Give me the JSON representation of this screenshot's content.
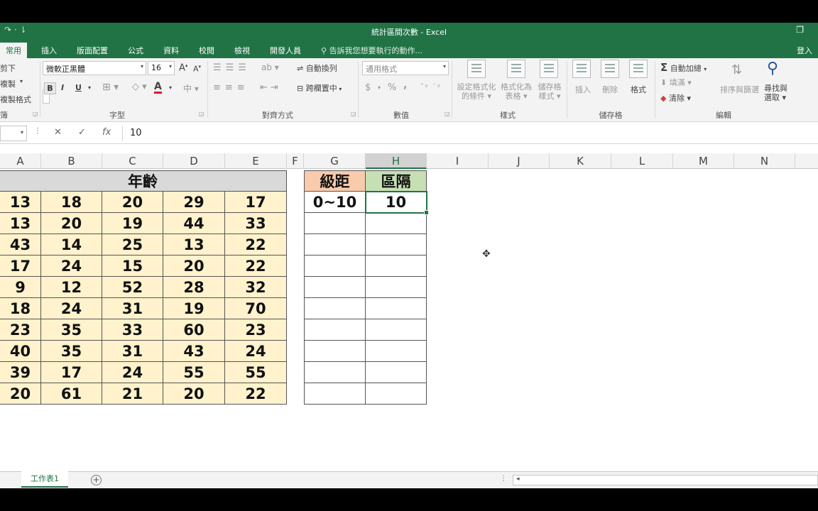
{
  "window": {
    "title": "統計區間次數 - Excel",
    "restore_icon": "restore-window-icon"
  },
  "tabs": {
    "items": [
      "常用",
      "插入",
      "版面配置",
      "公式",
      "資料",
      "校閱",
      "檢視",
      "開發人員"
    ],
    "active": "常用",
    "tell_me": "告訴我您想要執行的動作...",
    "signin": "登入"
  },
  "ribbon": {
    "clipboard": {
      "cut": "剪下",
      "copy": "複製",
      "format_painter": "複製格式",
      "group_label": "簿"
    },
    "font": {
      "name": "微軟正黑體",
      "size": "16",
      "bold": "B",
      "italic": "I",
      "underline": "U",
      "grow": "A",
      "shrink": "A",
      "font_color": "A",
      "font_color_hex": "#e81123",
      "group_label": "字型"
    },
    "alignment": {
      "wrap": "自動換列",
      "merge": "跨欄置中",
      "group_label": "對齊方式"
    },
    "number": {
      "format": "通用格式",
      "currency": "$",
      "percent": "%",
      "comma": ",",
      "group_label": "數值"
    },
    "styles": {
      "conditional": [
        "設定格式化",
        "的條件"
      ],
      "as_table": [
        "格式化為",
        "表格"
      ],
      "cell_styles": [
        "儲存格",
        "樣式"
      ],
      "group_label": "樣式"
    },
    "cells": {
      "insert": "插入",
      "delete": "刪除",
      "format": "格式",
      "group_label": "儲存格"
    },
    "editing": {
      "autosum": "自動加總",
      "fill": "填滿",
      "clear": "清除",
      "sort": "排序與篩選",
      "find": [
        "尋找與",
        "選取"
      ],
      "group_label": "編輯"
    }
  },
  "formula_bar": {
    "cancel": "✕",
    "enter": "✓",
    "fx": "fx",
    "value": "10"
  },
  "columns": [
    "A",
    "B",
    "C",
    "D",
    "E",
    "F",
    "G",
    "H",
    "I",
    "J",
    "K",
    "L",
    "M",
    "N"
  ],
  "selected_column": "H",
  "table": {
    "header": "年齡",
    "header_fill": "#d9d9d9",
    "cell_fill": "#fff2cc",
    "rows": [
      [
        "13",
        "18",
        "20",
        "29",
        "17"
      ],
      [
        "13",
        "20",
        "19",
        "44",
        "33"
      ],
      [
        "43",
        "14",
        "25",
        "13",
        "22"
      ],
      [
        "17",
        "24",
        "15",
        "20",
        "22"
      ],
      [
        "9",
        "12",
        "52",
        "28",
        "32"
      ],
      [
        "18",
        "24",
        "31",
        "19",
        "70"
      ],
      [
        "23",
        "35",
        "33",
        "60",
        "23"
      ],
      [
        "40",
        "35",
        "31",
        "43",
        "24"
      ],
      [
        "39",
        "17",
        "24",
        "55",
        "55"
      ],
      [
        "20",
        "61",
        "21",
        "20",
        "22"
      ]
    ]
  },
  "intervals": {
    "header_range": "級距",
    "header_interval": "區隔",
    "header_range_fill": "#f8cbad",
    "header_interval_fill": "#c6e0b4",
    "range_value": "0~10",
    "interval_value": "10"
  },
  "sheets": {
    "active": "工作表1",
    "add": "+"
  }
}
